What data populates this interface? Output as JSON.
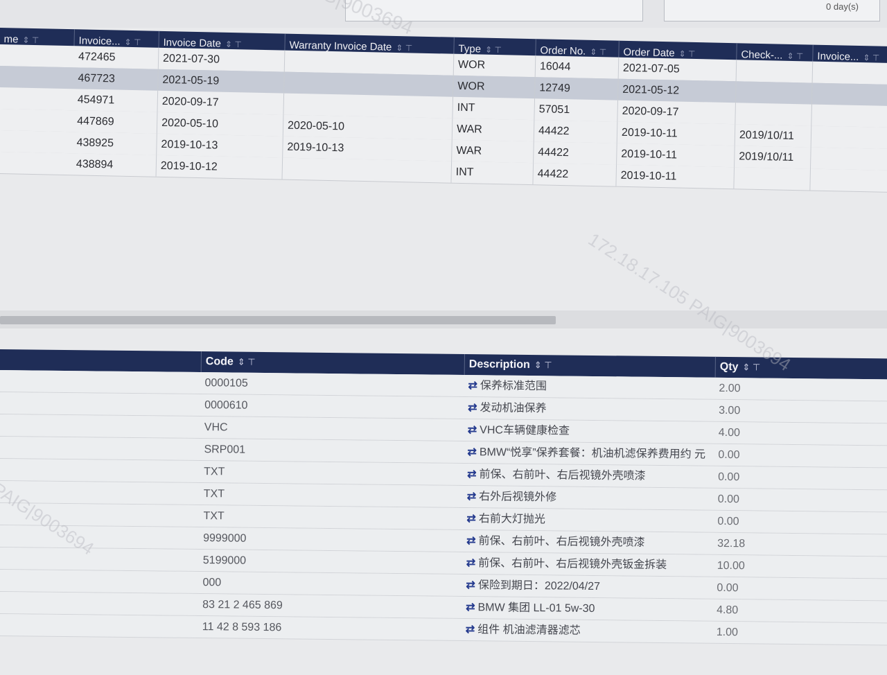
{
  "top": {
    "days_value": "0 day(s)"
  },
  "upper": {
    "columns": [
      "me",
      "Invoice...",
      "Invoice Date",
      "Warranty Invoice Date",
      "Type",
      "Order No.",
      "Order Date",
      "Check-...",
      "Invoice..."
    ],
    "rows": [
      {
        "invoice": "472465",
        "invoice_date": "2021-07-30",
        "warranty_date": "",
        "type": "WOR",
        "order_no": "16044",
        "order_date": "2021-07-05",
        "check": ""
      },
      {
        "invoice": "467723",
        "invoice_date": "2021-05-19",
        "warranty_date": "",
        "type": "WOR",
        "order_no": "12749",
        "order_date": "2021-05-12",
        "check": ""
      },
      {
        "invoice": "454971",
        "invoice_date": "2020-09-17",
        "warranty_date": "",
        "type": "INT",
        "order_no": "57051",
        "order_date": "2020-09-17",
        "check": ""
      },
      {
        "invoice": "447869",
        "invoice_date": "2020-05-10",
        "warranty_date": "2020-05-10",
        "type": "WAR",
        "order_no": "44422",
        "order_date": "2019-10-11",
        "check": "2019/10/11"
      },
      {
        "invoice": "438925",
        "invoice_date": "2019-10-13",
        "warranty_date": "2019-10-13",
        "type": "WAR",
        "order_no": "44422",
        "order_date": "2019-10-11",
        "check": "2019/10/11"
      },
      {
        "invoice": "438894",
        "invoice_date": "2019-10-12",
        "warranty_date": "",
        "type": "INT",
        "order_no": "44422",
        "order_date": "2019-10-11",
        "check": ""
      }
    ]
  },
  "lower": {
    "columns": [
      "Code",
      "Description",
      "Qty"
    ],
    "rows": [
      {
        "code": "0000105",
        "desc": "保养标准范围",
        "qty": "2.00"
      },
      {
        "code": "0000610",
        "desc": "发动机油保养",
        "qty": "3.00"
      },
      {
        "code": "VHC",
        "desc": "VHC车辆健康检查",
        "qty": "4.00"
      },
      {
        "code": "SRP001",
        "desc": "BMW“悦享”保养套餐：机油机滤保养费用约 元",
        "qty": "0.00"
      },
      {
        "code": "TXT",
        "desc": "前保、右前叶、右后视镜外壳喷漆",
        "qty": "0.00"
      },
      {
        "code": "TXT",
        "desc": "右外后视镜外修",
        "qty": "0.00"
      },
      {
        "code": "TXT",
        "desc": "右前大灯抛光",
        "qty": "0.00"
      },
      {
        "code": "9999000",
        "desc": "前保、右前叶、右后视镜外壳喷漆",
        "qty": "32.18"
      },
      {
        "code": "5199000",
        "desc": "前保、右前叶、右后视镜外壳钣金拆装",
        "qty": "10.00"
      },
      {
        "code": "000",
        "desc": "保险到期日：2022/04/27",
        "qty": "0.00"
      },
      {
        "code": "83 21 2 465 869",
        "desc": "BMW 集团 LL-01 5w-30",
        "qty": "4.80"
      },
      {
        "code": "11 42 8 593 186",
        "desc": "组件 机油滤清器滤芯",
        "qty": "1.00"
      }
    ]
  },
  "watermarks": {
    "a": "PAIG|9003694",
    "b": "172.18.17.105  PAIG|9003694",
    "c": "PAIG|9003694"
  },
  "icons": {
    "sort": "⇕",
    "filter": "⊤",
    "swap": "⇄"
  }
}
